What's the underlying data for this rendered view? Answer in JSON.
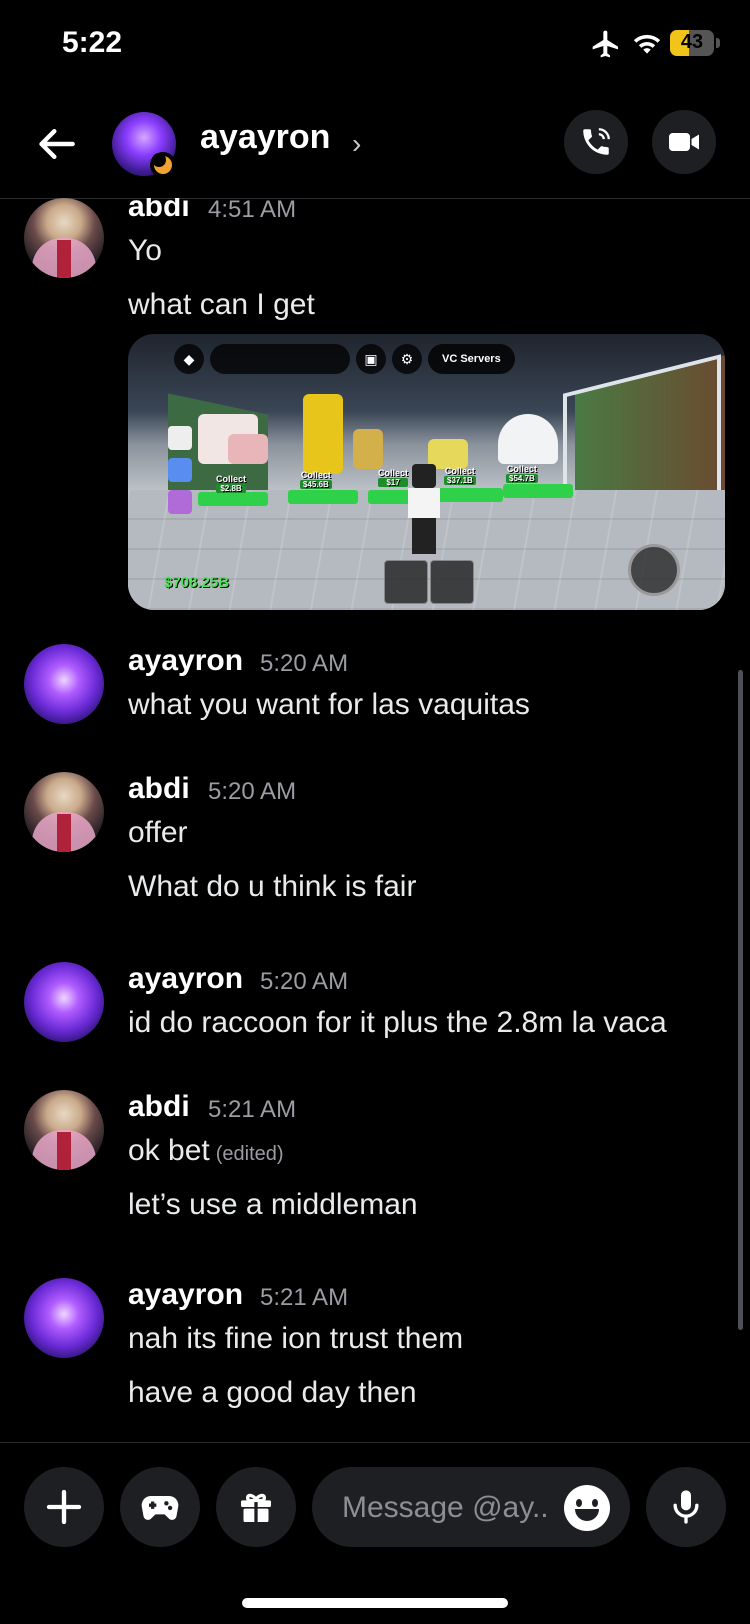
{
  "status_bar": {
    "time": "5:22",
    "battery": "43",
    "battery_fraction": 0.43
  },
  "header": {
    "name": "ayayron",
    "chevron": "›"
  },
  "messages": [
    {
      "author": "abdi",
      "time": "4:51 AM",
      "lines": [
        "Yo",
        "what can I get"
      ],
      "avatar": "abdi-avatar",
      "attachment": {
        "type": "game-screenshot",
        "button_label": "VC Servers",
        "money": "$708.25B",
        "collect_items": [
          {
            "label": "Collect",
            "value": "$2.8B"
          },
          {
            "label": "Collect",
            "value": "$45.6B"
          },
          {
            "label": "Collect",
            "value": "$17"
          },
          {
            "label": "Collect",
            "value": "$37.1B"
          },
          {
            "label": "Collect",
            "value": "$54.7B"
          }
        ]
      }
    },
    {
      "author": "ayayron",
      "time": "5:20 AM",
      "lines": [
        "what you want for las vaquitas"
      ],
      "avatar": "ayayron-avatar"
    },
    {
      "author": "abdi",
      "time": "5:20 AM",
      "lines": [
        "offer",
        "What do u think is fair"
      ],
      "avatar": "abdi-avatar"
    },
    {
      "author": "ayayron",
      "time": "5:20 AM",
      "lines": [
        "id do raccoon for it plus the 2.8m la vaca"
      ],
      "avatar": "ayayron-avatar"
    },
    {
      "author": "abdi",
      "time": "5:21 AM",
      "lines": [
        "ok bet",
        "let’s use a middleman"
      ],
      "edited": "(edited)",
      "avatar": "abdi-avatar"
    },
    {
      "author": "ayayron",
      "time": "5:21 AM",
      "lines": [
        "nah its fine ion trust them",
        "have a good day then"
      ],
      "avatar": "ayayron-avatar"
    }
  ],
  "composer": {
    "placeholder": "Message @ay.."
  },
  "icons": {
    "back": "arrow-left-icon",
    "call": "phone-icon",
    "video": "video-camera-icon",
    "add": "plus-icon",
    "games": "gamepad-icon",
    "gift": "gift-icon",
    "emoji": "emoji-icon",
    "mic": "microphone-icon"
  },
  "colors": {
    "background": "#000000",
    "surface": "#1e1f22",
    "text": "#f2f3f5",
    "muted": "#9b9da3",
    "battery": "#f0c419"
  }
}
